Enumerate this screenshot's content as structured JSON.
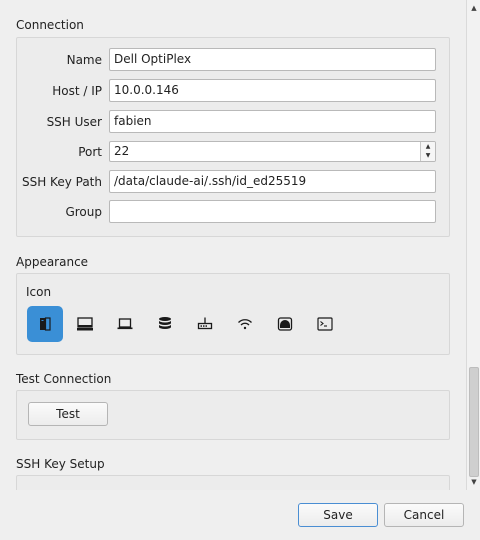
{
  "connection": {
    "title": "Connection",
    "fields": {
      "name": {
        "label": "Name",
        "value": "Dell OptiPlex"
      },
      "host": {
        "label": "Host / IP",
        "value": "10.0.0.146"
      },
      "user": {
        "label": "SSH User",
        "value": "fabien"
      },
      "port": {
        "label": "Port",
        "value": "22"
      },
      "key_path": {
        "label": "SSH Key Path",
        "value": "/data/claude-ai/.ssh/id_ed25519"
      },
      "group": {
        "label": "Group",
        "value": ""
      }
    }
  },
  "appearance": {
    "title": "Appearance",
    "icon_label": "Icon",
    "icons": [
      "tower-icon",
      "desktop-icon",
      "laptop-icon",
      "database-icon",
      "router-icon",
      "wifi-icon",
      "nas-icon",
      "terminal-icon"
    ],
    "selected_icon": "tower-icon",
    "accent": "#3a8fd6"
  },
  "test": {
    "title": "Test Connection",
    "button_label": "Test"
  },
  "ssh_setup": {
    "title": "SSH Key Setup"
  },
  "footer": {
    "save_label": "Save",
    "cancel_label": "Cancel"
  }
}
